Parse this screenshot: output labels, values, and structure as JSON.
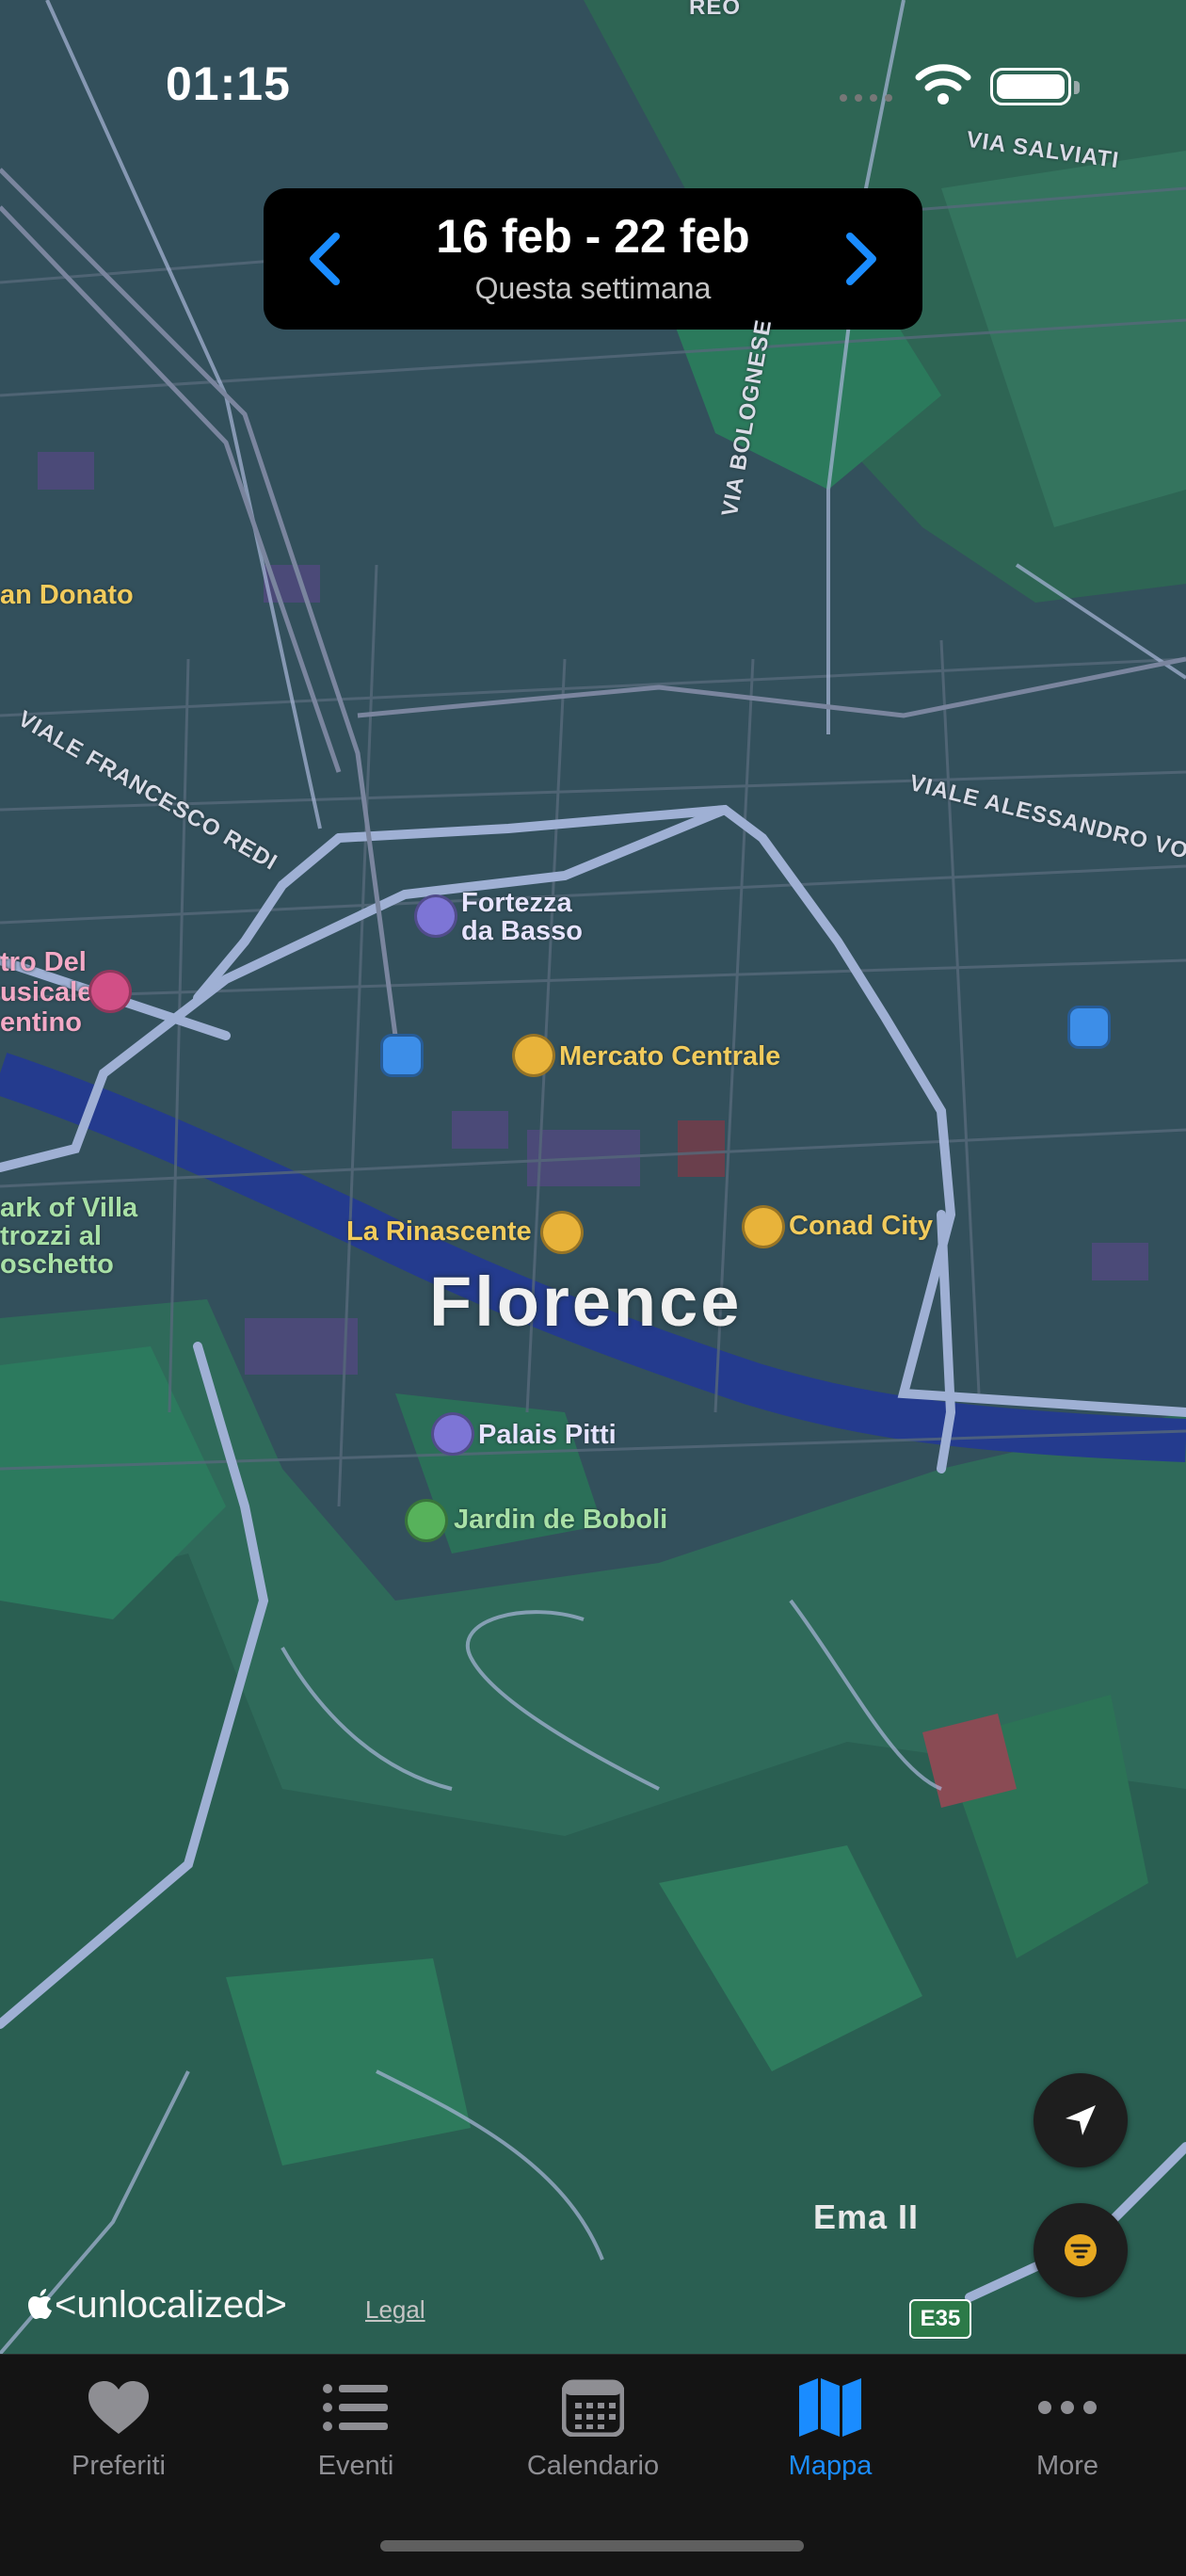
{
  "status_bar": {
    "time": "01:15"
  },
  "week_selector": {
    "range": "16 feb - 22 feb",
    "subtitle": "Questa settimana",
    "prev_icon": "chevron-left-icon",
    "next_icon": "chevron-right-icon"
  },
  "map": {
    "city_label": "Florence",
    "places": [
      {
        "name": "Fortezza\nda Basso",
        "icon": "fortress-icon"
      },
      {
        "name": "Mercato Centrale",
        "icon": "shopping-bag-icon"
      },
      {
        "name": "La Rinascente",
        "icon": "shopping-bag-icon"
      },
      {
        "name": "Conad City",
        "icon": "cart-icon"
      },
      {
        "name": "Palais Pitti",
        "icon": "palace-icon"
      },
      {
        "name": "Jardin de Boboli",
        "icon": "garden-icon"
      }
    ],
    "partial_labels": {
      "san_donato": "an Donato",
      "teatro": "tro Del\nusicale\nentino",
      "park": "ark of Villa\ntrozzi al\noschetto"
    },
    "roads": {
      "via_salviati": "VIA SALVIATI",
      "via_bolognese": "VIA BOLOGNESE",
      "viale_redi": "VIALE FRANCESCO REDI",
      "viale_alessandro": "VIALE ALESSANDRO VO",
      "top_fragment": "REO"
    },
    "ema": "Ema II",
    "highway_badge": "E35",
    "attribution": "<unlocalized>",
    "legal": "Legal"
  },
  "colors": {
    "accent": "#1a8cff",
    "poi_yellow": "#e8b33a",
    "poi_lavender": "#7d75d6",
    "poi_green": "#57b25b",
    "transit_blue": "#3d8ee8"
  },
  "tabs": [
    {
      "label": "Preferiti",
      "icon": "heart-icon",
      "active": false
    },
    {
      "label": "Eventi",
      "icon": "list-icon",
      "active": false
    },
    {
      "label": "Calendario",
      "icon": "calendar-icon",
      "active": false
    },
    {
      "label": "Mappa",
      "icon": "map-icon",
      "active": true
    },
    {
      "label": "More",
      "icon": "ellipsis-icon",
      "active": false
    }
  ]
}
